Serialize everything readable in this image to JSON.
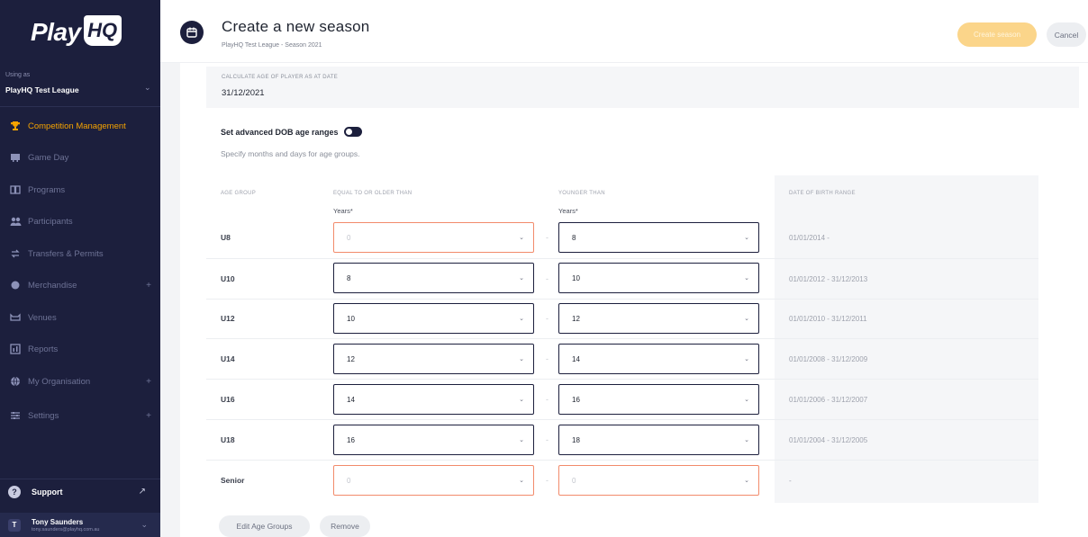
{
  "sidebar": {
    "logo_text": "Play",
    "logo_hq": "HQ",
    "org_label": "Using as",
    "org_name": "PlayHQ Test League",
    "nav": [
      {
        "label": "Competition Management",
        "icon": "trophy-icon",
        "active": true
      },
      {
        "label": "Game Day",
        "icon": "scoreboard-icon"
      },
      {
        "label": "Programs",
        "icon": "programs-icon"
      },
      {
        "label": "Participants",
        "icon": "people-icon"
      },
      {
        "label": "Transfers & Permits",
        "icon": "transfer-icon"
      },
      {
        "label": "Merchandise",
        "icon": "merchandise-icon",
        "expandable": true
      },
      {
        "label": "Venues",
        "icon": "venue-icon"
      },
      {
        "label": "Reports",
        "icon": "reports-icon"
      },
      {
        "label": "My Organisation",
        "icon": "globe-icon",
        "expandable": true
      },
      {
        "label": "Settings",
        "icon": "settings-icon",
        "expandable": true
      }
    ],
    "support_label": "Support",
    "user_name": "Tony Saunders",
    "user_email": "tony.saunders@playhq.com.au",
    "user_initial": "T"
  },
  "header": {
    "title": "Create a new season",
    "subtitle": "PlayHQ Test League - Season 2021",
    "primary_button": "Create season",
    "cancel_button": "Cancel"
  },
  "age_date": {
    "label": "CALCULATE AGE OF PLAYER AS AT DATE",
    "value": "31/12/2021"
  },
  "advanced": {
    "label": "Set advanced DOB age ranges",
    "helper": "Specify months and days for age groups."
  },
  "table": {
    "headers": {
      "age_group": "AGE GROUP",
      "older": "EQUAL TO OR OLDER THAN",
      "younger": "YOUNGER THAN",
      "dob": "DATE OF BIRTH RANGE"
    },
    "years_label": "Years*",
    "rows": [
      {
        "group": "U8",
        "from": "0",
        "to": "8",
        "dob": "01/01/2014 -",
        "from_invalid": true,
        "to_invalid": false
      },
      {
        "group": "U10",
        "from": "8",
        "to": "10",
        "dob": "01/01/2012 - 31/12/2013",
        "from_invalid": false,
        "to_invalid": false
      },
      {
        "group": "U12",
        "from": "10",
        "to": "12",
        "dob": "01/01/2010 - 31/12/2011",
        "from_invalid": false,
        "to_invalid": false
      },
      {
        "group": "U14",
        "from": "12",
        "to": "14",
        "dob": "01/01/2008 - 31/12/2009",
        "from_invalid": false,
        "to_invalid": false
      },
      {
        "group": "U16",
        "from": "14",
        "to": "16",
        "dob": "01/01/2006 - 31/12/2007",
        "from_invalid": false,
        "to_invalid": false
      },
      {
        "group": "U18",
        "from": "16",
        "to": "18",
        "dob": "01/01/2004 - 31/12/2005",
        "from_invalid": false,
        "to_invalid": false
      },
      {
        "group": "Senior",
        "from": "0",
        "to": "0",
        "dob": "-",
        "from_invalid": true,
        "to_invalid": true
      }
    ]
  },
  "actions": {
    "edit": "Edit Age Groups",
    "remove": "Remove"
  },
  "colors": {
    "sidebar_bg": "#1c1f3d",
    "accent": "#f5a300",
    "invalid_border": "#f28b6b"
  }
}
